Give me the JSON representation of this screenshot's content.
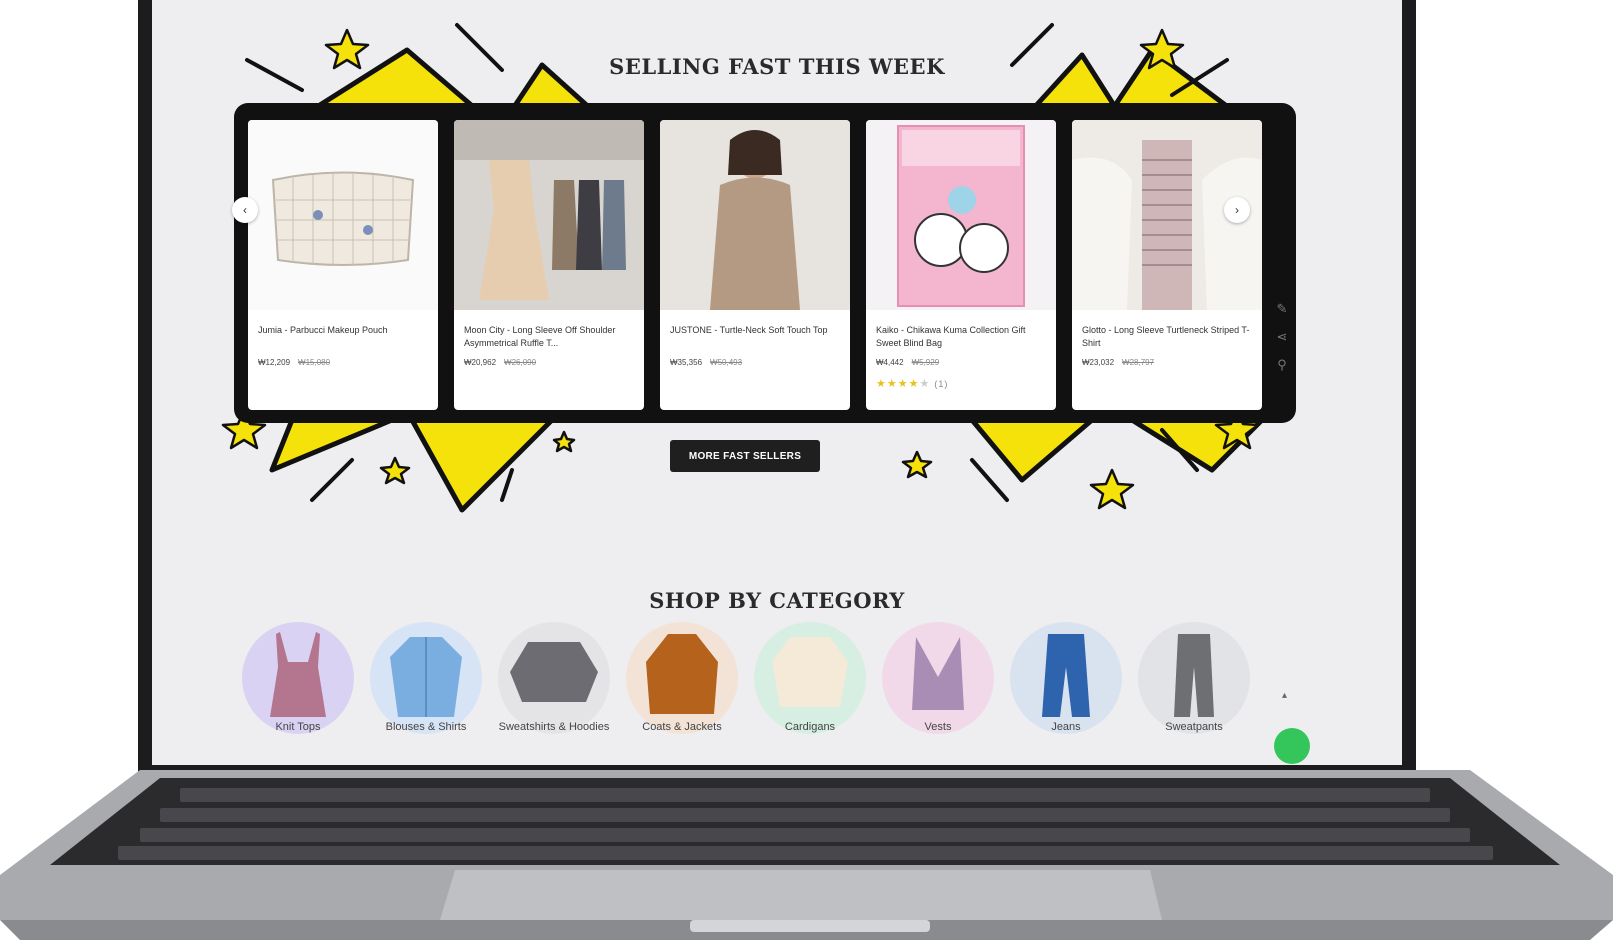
{
  "sections": {
    "fast_title": "SELLING FAST THIS WEEK",
    "category_title": "SHOP BY CATEGORY",
    "more_button": "MORE FAST SELLERS"
  },
  "products": [
    {
      "name": "Jumia - Parbucci Makeup Pouch",
      "price": "₩12,209",
      "old_price": "₩15,080",
      "has_rating": false
    },
    {
      "name": "Moon City - Long Sleeve Off Shoulder Asymmetrical Ruffle T...",
      "price": "₩20,962",
      "old_price": "₩26,090",
      "has_rating": false
    },
    {
      "name": "JUSTONE - Turtle-Neck Soft Touch Top",
      "price": "₩35,356",
      "old_price": "₩50,493",
      "has_rating": false
    },
    {
      "name": "Kaiko - Chikawa Kuma Collection Gift Sweet Blind Bag",
      "price": "₩4,442",
      "old_price": "₩5,929",
      "has_rating": true,
      "rating": 4,
      "rating_count": "(1)"
    },
    {
      "name": "Glotto - Long Sleeve Turtleneck Striped T-Shirt",
      "price": "₩23,032",
      "old_price": "₩28,797",
      "has_rating": false
    }
  ],
  "categories": [
    {
      "label": "Knit Tops",
      "bg": "#d9d2f2"
    },
    {
      "label": "Blouses & Shirts",
      "bg": "#d7e4f5"
    },
    {
      "label": "Sweatshirts & Hoodies",
      "bg": "#e4e4e6"
    },
    {
      "label": "Coats & Jackets",
      "bg": "#f3e3d6"
    },
    {
      "label": "Cardigans",
      "bg": "#d6efe2"
    },
    {
      "label": "Vests",
      "bg": "#f2d9ea"
    },
    {
      "label": "Jeans",
      "bg": "#d9e3ef"
    },
    {
      "label": "Sweatpants",
      "bg": "#e1e3e6"
    }
  ],
  "colors": {
    "accent_yellow": "#f5e20a",
    "dark": "#111111",
    "screen_bg": "#eeedf0"
  },
  "icons": {
    "prev": "chevron-left-icon",
    "next": "chevron-right-icon",
    "chat": "chat-icon"
  }
}
